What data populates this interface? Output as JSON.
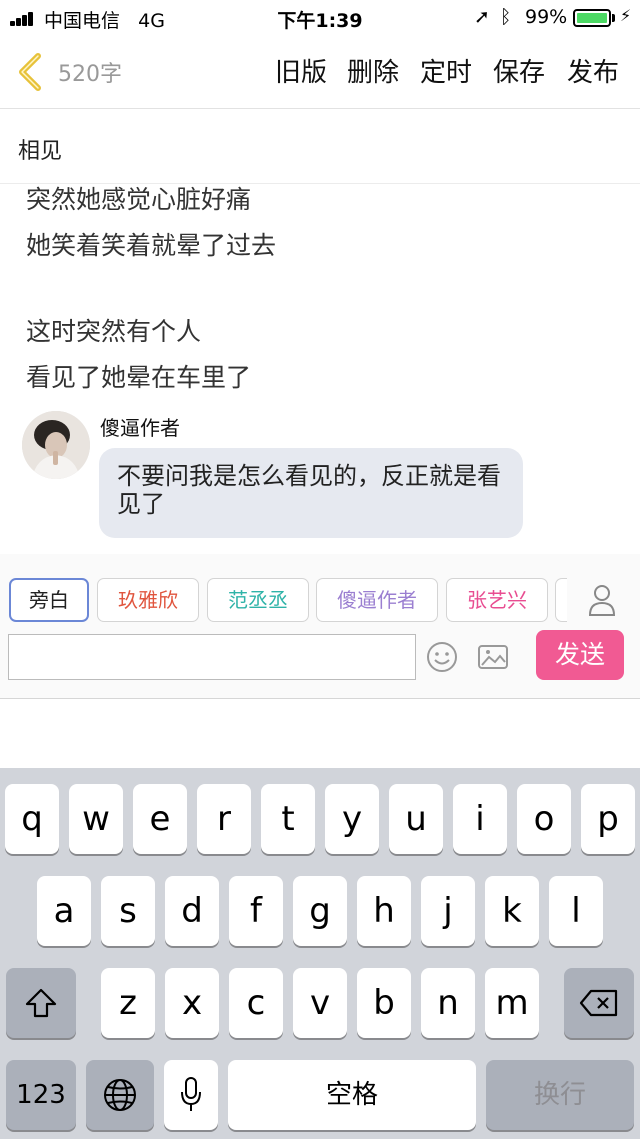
{
  "status_bar": {
    "carrier": "中国电信",
    "network": "4G",
    "time": "下午1:39",
    "battery_percent": "99%",
    "battery_level": 0.99
  },
  "nav": {
    "word_count": "520字",
    "buttons": [
      "旧版",
      "删除",
      "定时",
      "保存",
      "发布"
    ]
  },
  "story": {
    "title": "相见",
    "lines": [
      "突然她感觉心脏好痛",
      "她笑着笑着就晕了过去",
      "这时突然有个人",
      "看见了她晕在车里了"
    ]
  },
  "message": {
    "author": "傻逼作者",
    "text": "不要问我是怎么看见的，反正就是看见了"
  },
  "roles": [
    {
      "label": "旁白",
      "color": "#222222"
    },
    {
      "label": "玖雅欣",
      "color": "#e0553e"
    },
    {
      "label": "范丞丞",
      "color": "#2fb3a8"
    },
    {
      "label": "傻逼作者",
      "color": "#9b7fd1"
    },
    {
      "label": "张艺兴",
      "color": "#e84d91"
    }
  ],
  "composer": {
    "input_value": "",
    "send_label": "发送"
  },
  "keyboard": {
    "row1": [
      "q",
      "w",
      "e",
      "r",
      "t",
      "y",
      "u",
      "i",
      "o",
      "p"
    ],
    "row2": [
      "a",
      "s",
      "d",
      "f",
      "g",
      "h",
      "j",
      "k",
      "l"
    ],
    "row3": [
      "z",
      "x",
      "c",
      "v",
      "b",
      "n",
      "m"
    ],
    "numbers_key": "123",
    "space_label": "空格",
    "return_label": "换行"
  },
  "colors": {
    "accent_pink": "#f15a93",
    "back_arrow": "#e7c23a",
    "selected_border": "#6b87d6"
  }
}
